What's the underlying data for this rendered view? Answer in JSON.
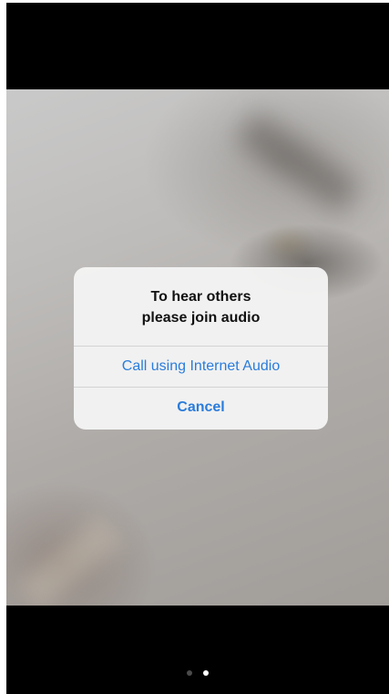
{
  "dialog": {
    "title_line1": "To hear others",
    "title_line2": "please join audio",
    "buttons": {
      "internet_audio": "Call using Internet Audio",
      "cancel": "Cancel"
    },
    "accent_color": "#2a7cdb"
  },
  "pager": {
    "count": 2,
    "active_index": 1
  }
}
